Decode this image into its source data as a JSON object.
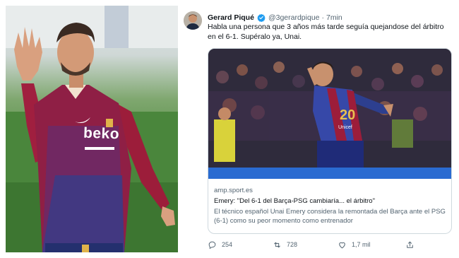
{
  "tweet": {
    "display_name": "Gerard Piqué",
    "handle": "@3gerardpique",
    "separator": "·",
    "time": "7min",
    "text": "Habla una persona que 3 años más tarde seguía quejandose del árbitro en el 6-1. Supéralo ya, Unai.",
    "card": {
      "domain": "amp.sport.es",
      "title": "Emery: \"Del 6-1 del Barça-PSG cambiaría... el árbitro\"",
      "description": "El técnico español Unai Emery considera la remontada del Barça ante el PSG (6-1) como su peor momento como entrenador"
    },
    "actions": {
      "reply_count": "254",
      "retweet_count": "728",
      "like_count": "1,7 mil"
    }
  },
  "photo": {
    "jersey_sponsor": "beko"
  },
  "card_photo": {
    "shirt_number": "20",
    "shirt_sponsor": "Unicef"
  },
  "icons": {
    "verified": "verified-badge-icon",
    "reply": "reply-icon",
    "retweet": "retweet-icon",
    "like": "heart-icon",
    "share": "share-icon"
  },
  "colors": {
    "verified_blue": "#1d9bf0",
    "text_primary": "#0f1419",
    "text_secondary": "#536471",
    "card_border": "#cfd9de",
    "jersey_red": "#9c1d3a",
    "jersey_blue": "#2d3f8f"
  }
}
